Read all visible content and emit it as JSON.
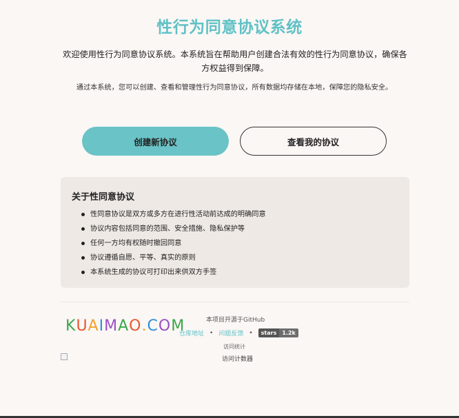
{
  "title": "性行为同意协议系统",
  "intro": "欢迎使用性行为同意协议系统。本系统旨在帮助用户创建合法有效的性行为同意协议，确保各方权益得到保障。",
  "subtext": "通过本系统，您可以创建、查看和管理性行为同意协议，所有数据均存储在本地，保障您的隐私安全。",
  "buttons": {
    "create": "创建新协议",
    "view": "查看我的协议"
  },
  "about": {
    "title": "关于性同意协议",
    "items": [
      "性同意协议是双方或多方在进行性活动前达成的明确同意",
      "协议内容包括同意的范围、安全措施、隐私保护等",
      "任何一方均有权随时撤回同意",
      "协议遵循自愿、平等、真实的原则",
      "本系统生成的协议可打印出来供双方手签"
    ]
  },
  "footer": {
    "logo_text": "KUAIMAO.COM",
    "logo_colors": [
      "#3aa84a",
      "#e8562f",
      "#f2a12c",
      "#2f8ed8",
      "#9a4fc4"
    ],
    "opensource": "本项目开源于GitHub",
    "repo_link": "仓库地址",
    "issue_link": "问题反馈",
    "separator": "•",
    "badge_label": "stars",
    "badge_value": "1.2k",
    "visit_stats": "访问统计",
    "counter_alt": "访问计数器"
  },
  "colors": {
    "accent": "#5fc1c5",
    "button_primary": "#6ac3c6",
    "background": "#fbf7f5",
    "card": "#efe9e5"
  }
}
